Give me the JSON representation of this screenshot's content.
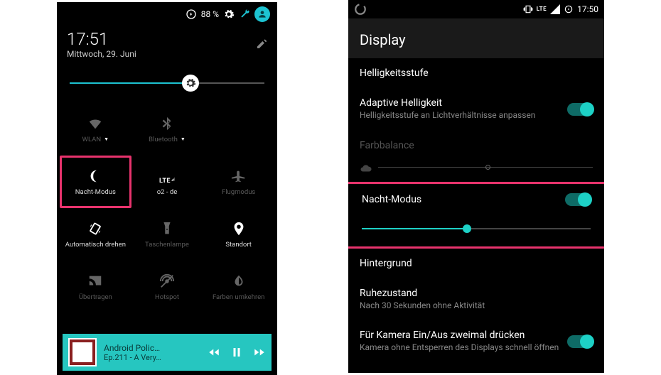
{
  "left": {
    "status": {
      "battery_pct": "88 %",
      "battery_icon": "battery-circle",
      "settings_icon": "gear",
      "profile_icon": "profile"
    },
    "time": "17:51",
    "date": "Mittwoch, 29. Juni",
    "brightness": {
      "value_pct": 62
    },
    "tiles": [
      {
        "id": "wlan",
        "label": "WLAN",
        "icon": "wifi",
        "dim": true,
        "caret": true
      },
      {
        "id": "bluetooth",
        "label": "Bluetooth",
        "icon": "bluetooth",
        "dim": true,
        "caret": true
      },
      {
        "id": "blank",
        "label": "",
        "icon": "",
        "dim": true
      },
      {
        "id": "night",
        "label": "Nacht-Modus",
        "icon": "moon",
        "active": true,
        "highlight": true
      },
      {
        "id": "cell",
        "label": "o2 - de",
        "icon": "lte",
        "caret": false
      },
      {
        "id": "airplane",
        "label": "Flugmodus",
        "icon": "airplane",
        "dim": true
      },
      {
        "id": "rotate",
        "label": "Automatisch drehen",
        "icon": "rotate"
      },
      {
        "id": "flash",
        "label": "Taschenlampe",
        "icon": "flashlight",
        "dim": true
      },
      {
        "id": "location",
        "label": "Standort",
        "icon": "location"
      },
      {
        "id": "cast",
        "label": "Übertragen",
        "icon": "cast",
        "dim": true
      },
      {
        "id": "hotspot",
        "label": "Hotspot",
        "icon": "hotspot",
        "dim": true
      },
      {
        "id": "invert",
        "label": "Farben umkehren",
        "icon": "invert",
        "dim": true
      }
    ],
    "player": {
      "line1": "Android Polic…",
      "line2": "Ep.211 - A Very…"
    }
  },
  "right": {
    "status": {
      "time": "17:50",
      "lte": "LTE"
    },
    "title": "Display",
    "items": {
      "brightlevel": {
        "title": "Helligkeitsstufe"
      },
      "adaptive": {
        "title": "Adaptive Helligkeit",
        "sub": "Helligkeitsstufe an Lichtverhältnisse anpassen",
        "on": true
      },
      "colorbalance": {
        "title": "Farbbalance",
        "slider_pct": 50,
        "disabled": true
      },
      "nightmode": {
        "title": "Nacht-Modus",
        "on": true,
        "slider_pct": 46
      },
      "wallpaper": {
        "title": "Hintergrund"
      },
      "sleep": {
        "title": "Ruhezustand",
        "sub": "Nach 30 Sekunden ohne Aktivität"
      },
      "camerakey": {
        "title": "Für Kamera Ein/Aus zweimal drücken",
        "sub": "Kamera ohne Entsperren des Displays schnell öffnen",
        "on": true
      }
    }
  }
}
